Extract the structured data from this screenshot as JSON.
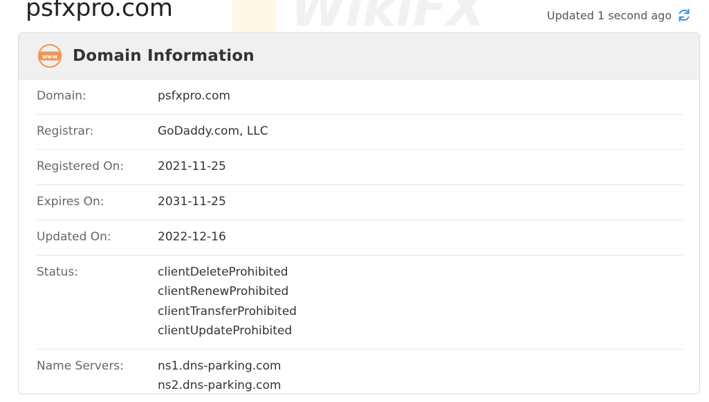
{
  "header": {
    "domain_title": "psfxpro.com",
    "updated_text": "Updated 1 second ago"
  },
  "card": {
    "title": "Domain Information",
    "icon_text": "www",
    "rows": {
      "domain": {
        "label": "Domain:",
        "value": "psfxpro.com"
      },
      "registrar": {
        "label": "Registrar:",
        "value": "GoDaddy.com, LLC"
      },
      "registered_on": {
        "label": "Registered On:",
        "value": "2021-11-25"
      },
      "expires_on": {
        "label": "Expires On:",
        "value": "2031-11-25"
      },
      "updated_on": {
        "label": "Updated On:",
        "value": "2022-12-16"
      },
      "status": {
        "label": "Status:",
        "values": [
          "clientDeleteProhibited",
          "clientRenewProhibited",
          "clientTransferProhibited",
          "clientUpdateProhibited"
        ]
      },
      "name_servers": {
        "label": "Name Servers:",
        "values": [
          "ns1.dns-parking.com",
          "ns2.dns-parking.com"
        ]
      }
    }
  },
  "watermark": {
    "text": "WikiFX"
  },
  "colors": {
    "accent_orange": "#f0965a",
    "refresh_blue": "#3a8fd8"
  }
}
